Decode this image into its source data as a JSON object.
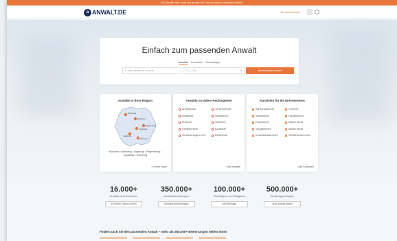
{
  "topbar": {
    "text": "Ob Anwalt oder nicht auf anwalt.de? Jetzt | Neues kostenlos testen!"
  },
  "nav": {
    "logo_mark": "a",
    "logo_text": "ANWALT.DE",
    "cta": "Sie sind Anwalt?"
  },
  "hero": {
    "title": "Einfach zum passenden Anwalt",
    "tabs": [
      "Anwälte",
      "Kanzleien",
      "Rechtstipps"
    ],
    "what_placeholder": "Rechtsthema / Name",
    "where_placeholder": "PLZ / Ort",
    "search_button": "Jetzt Anwalt suchen"
  },
  "regions_card": {
    "title": "Anwälte in Ihrer Region",
    "cities": [
      "Nürnberg",
      "Würzburg",
      "Regensburg",
      "Ingolstadt",
      "Augsburg",
      "München"
    ],
    "region_text": "München • Nürnberg • Augsburg • Regensburg • Ingolstadt • Würzburg",
    "link": "In Ihrer Nähe"
  },
  "law_card": {
    "title": "Anwälte zu jedem Rechtsgebiet",
    "items": [
      "Arbeitsrecht",
      "Verkehrsrecht",
      "Strafrecht",
      "Sozialrecht",
      "Erbrecht",
      "Mietrecht",
      "Familienrecht",
      "Kaufrecht",
      "Versicherungs-recht",
      "Reiserecht"
    ],
    "link": "Alle Anwälte"
  },
  "business_card": {
    "title": "Kanzleien für Ihr Unternehmen",
    "items": [
      "Wirtschaftsrecht",
      "IT-Recht",
      "Arbeitsrecht",
      "Handelsrecht",
      "Patentrecht",
      "Markenrecht",
      "Vergaberecht",
      "Medienrecht",
      "Gesellschafts-recht",
      "Wettbewerbs-recht"
    ],
    "link": "Alle Kanzleien"
  },
  "stats": [
    {
      "num": "16.000+",
      "label": "Anwälte und Kanzleien",
      "button": "In meiner Nähe suchen"
    },
    {
      "num": "350.000+",
      "label": "Anwaltsbewertungen",
      "button": "Neueste Bewertungen"
    },
    {
      "num": "100.000+",
      "label": "Rechtstipps und Ratgeber",
      "button": "Alle Beiträge"
    },
    {
      "num": "500.000+",
      "label": "Beratungsanfragen",
      "button": "Jetzt Anwalt finden"
    }
  ],
  "footer": {
    "text": "Finden auch Sie den passenden Anwalt – mehr als 350.000+ Bewertungen helfen Ihnen"
  },
  "colors": {
    "accent": "#e8753a",
    "brand": "#1c2f5a"
  }
}
